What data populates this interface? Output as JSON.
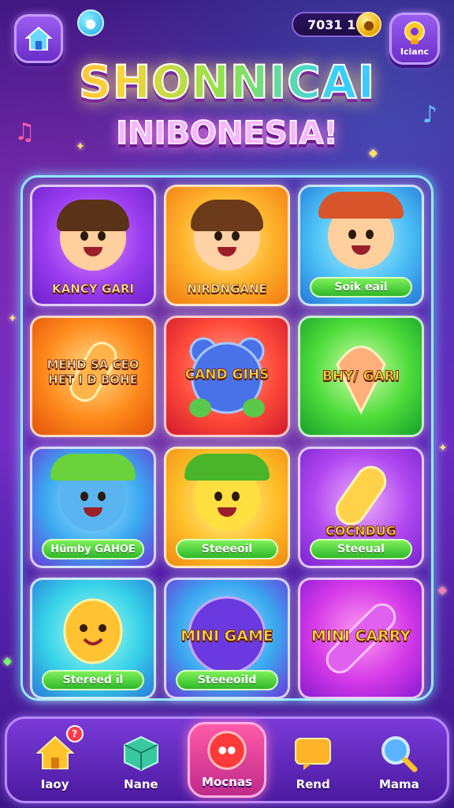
{
  "header": {
    "home_icon": "home-icon",
    "chat_icon": "chat-bubble-icon",
    "coin_count": "7031 10",
    "trophy_icon": "trophy-icon",
    "trophy_label": "Icianc"
  },
  "title": {
    "main": "SHONNICAI",
    "sub": "INIBONESIA!"
  },
  "games": [
    {
      "name": "KANCY GARI",
      "bg": "purple",
      "art": "girl-waving"
    },
    {
      "name": "NIRDNGANE",
      "bg": "orange",
      "art": "cat-girl"
    },
    {
      "name": "Soik eail",
      "bg": "blue",
      "art": "boy-hat"
    },
    {
      "name": "MEHD SA CEO HET I D BOHE",
      "bg": "orange2",
      "art": "popsicle"
    },
    {
      "name": "CAND GIHS",
      "bg": "red",
      "art": "blue-bear"
    },
    {
      "name": "BHY/ GARI",
      "bg": "green",
      "art": "spinning-top"
    },
    {
      "name": "Hümby GAHOE",
      "bg": "blue2",
      "art": "blue-monster"
    },
    {
      "name": "Steeeoil",
      "bg": "gold",
      "art": "yellow-creature"
    },
    {
      "name": "COCNDUG",
      "sub": "Steeual",
      "bg": "violet",
      "art": "candy"
    },
    {
      "name": "Stereed il",
      "bg": "cyan",
      "art": "orange-fruit"
    },
    {
      "name": "MINI GAME",
      "sub": "Steeeoild",
      "bg": "blue2",
      "art": "purple-ball"
    },
    {
      "name": "MINI CARRY",
      "bg": "magenta",
      "art": "pink-candy"
    }
  ],
  "nav": {
    "items": [
      {
        "label": "Iaoy",
        "icon": "home-icon",
        "badge": "?"
      },
      {
        "label": "Nane",
        "icon": "box-icon",
        "badge": ""
      },
      {
        "label": "Mocnas",
        "icon": "game-icon",
        "badge": ""
      },
      {
        "label": "Rend",
        "icon": "message-icon",
        "badge": ""
      },
      {
        "label": "Mama",
        "icon": "search-icon",
        "badge": ""
      }
    ]
  }
}
